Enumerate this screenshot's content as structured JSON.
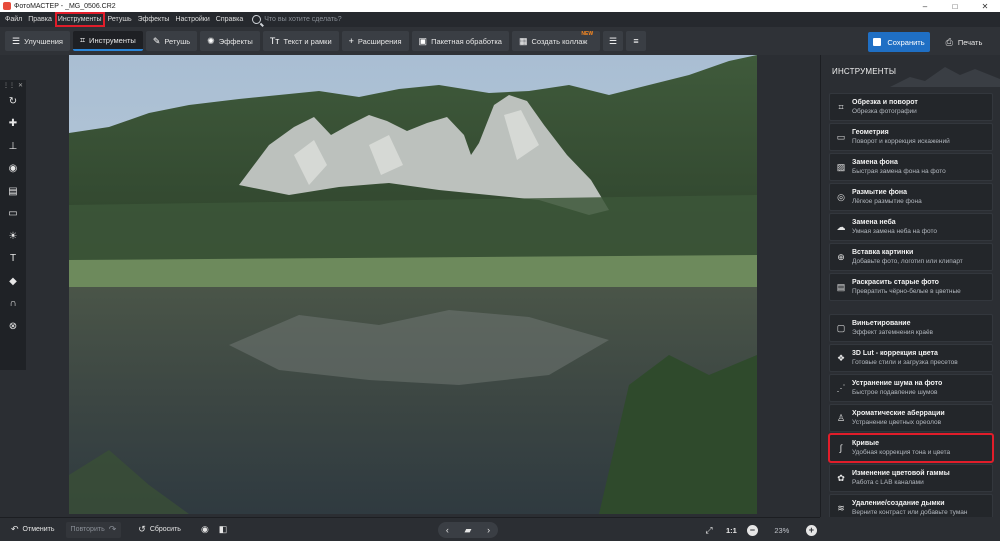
{
  "titlebar": {
    "title": "ФотоМАСТЕР - _MG_0506.CR2",
    "min": "–",
    "max": "□",
    "close": "✕"
  },
  "menu": {
    "items": [
      "Файл",
      "Правка",
      "Инструменты",
      "Ретушь",
      "Эффекты",
      "Настройки",
      "Справка"
    ],
    "highlighted_index": 2,
    "search_placeholder": "Что вы хотите сделать?"
  },
  "toolbar": {
    "tabs": [
      {
        "label": "Улучшения",
        "icon": "enhance-icon",
        "glyph": "☰"
      },
      {
        "label": "Инструменты",
        "icon": "crop-icon",
        "glyph": "⌗",
        "active": true
      },
      {
        "label": "Ретушь",
        "icon": "brush-icon",
        "glyph": "✎"
      },
      {
        "label": "Эффекты",
        "icon": "sparkle-icon",
        "glyph": "✺"
      },
      {
        "label": "Текст и рамки",
        "icon": "text-icon",
        "glyph": "Tт"
      },
      {
        "label": "Расширения",
        "icon": "plus-icon",
        "glyph": "+"
      },
      {
        "label": "Пакетная обработка",
        "icon": "batch-icon",
        "glyph": "▣"
      },
      {
        "label": "Создать коллаж",
        "icon": "collage-icon",
        "glyph": "▦",
        "badge": "NEW"
      }
    ],
    "extra_icons": [
      "history-icon",
      "settings-list-icon"
    ],
    "save_label": "Сохранить",
    "print_label": "Печать"
  },
  "left_tools": [
    "rotate-icon",
    "healing-icon",
    "stamp-icon",
    "target-icon",
    "gradient-filter-icon",
    "vignette-icon",
    "sun-icon",
    "text-icon",
    "fill-icon",
    "magnet-icon",
    "globe-icon"
  ],
  "right_panel": {
    "title": "ИНСТРУМЕНТЫ",
    "cards": [
      {
        "name": "Обрезка и поворот",
        "desc": "Обрезка фотографии",
        "icon": "crop-icon",
        "glyph": "⌗"
      },
      {
        "name": "Геометрия",
        "desc": "Поворот и коррекция искажений",
        "icon": "geometry-icon",
        "glyph": "▭"
      },
      {
        "name": "Замена фона",
        "desc": "Быстрая замена фона на фото",
        "icon": "background-icon",
        "glyph": "▨"
      },
      {
        "name": "Размытие фона",
        "desc": "Лёгкое размытие фона",
        "icon": "blur-icon",
        "glyph": "◎"
      },
      {
        "name": "Замена неба",
        "desc": "Умная замена неба на фото",
        "icon": "sky-icon",
        "glyph": "☁"
      },
      {
        "name": "Вставка картинки",
        "desc": "Добавьте фото, логотип или клипарт",
        "icon": "insert-image-icon",
        "glyph": "⊕"
      },
      {
        "name": "Раскрасить старые фото",
        "desc": "Превратить чёрно-белые в цветные",
        "icon": "colorize-icon",
        "glyph": "▤"
      },
      {
        "name": "Виньетирование",
        "desc": "Эффект затемнения краёв",
        "icon": "vignette-icon",
        "glyph": "▢"
      },
      {
        "name": "3D Lut - коррекция цвета",
        "desc": "Готовые стили и загрузка пресетов",
        "icon": "lut-icon",
        "glyph": "❖"
      },
      {
        "name": "Устранение шума на фото",
        "desc": "Быстрое подавление шумов",
        "icon": "denoise-icon",
        "glyph": "⋰"
      },
      {
        "name": "Хроматические аберрации",
        "desc": "Устранение цветных ореолов",
        "icon": "aberration-icon",
        "glyph": "♙"
      },
      {
        "name": "Кривые",
        "desc": "Удобная коррекция тона и цвета",
        "icon": "curves-icon",
        "glyph": "∫",
        "highlight": true
      },
      {
        "name": "Изменение цветовой гаммы",
        "desc": "Работа с LAB каналами",
        "icon": "color-gamut-icon",
        "glyph": "✿"
      },
      {
        "name": "Удаление/создание дымки",
        "desc": "Верните контраст или добавьте туман",
        "icon": "haze-icon",
        "glyph": "≋"
      }
    ]
  },
  "bottom": {
    "undo_label": "Отменить",
    "redo_label": "Повторить",
    "reset_label": "Сбросить",
    "ratio_label": "1:1",
    "zoom_value": "23%"
  },
  "colors": {
    "accent": "#1f6fc4",
    "highlight_red": "#e11d2a",
    "new_badge": "#ff8a1e"
  }
}
